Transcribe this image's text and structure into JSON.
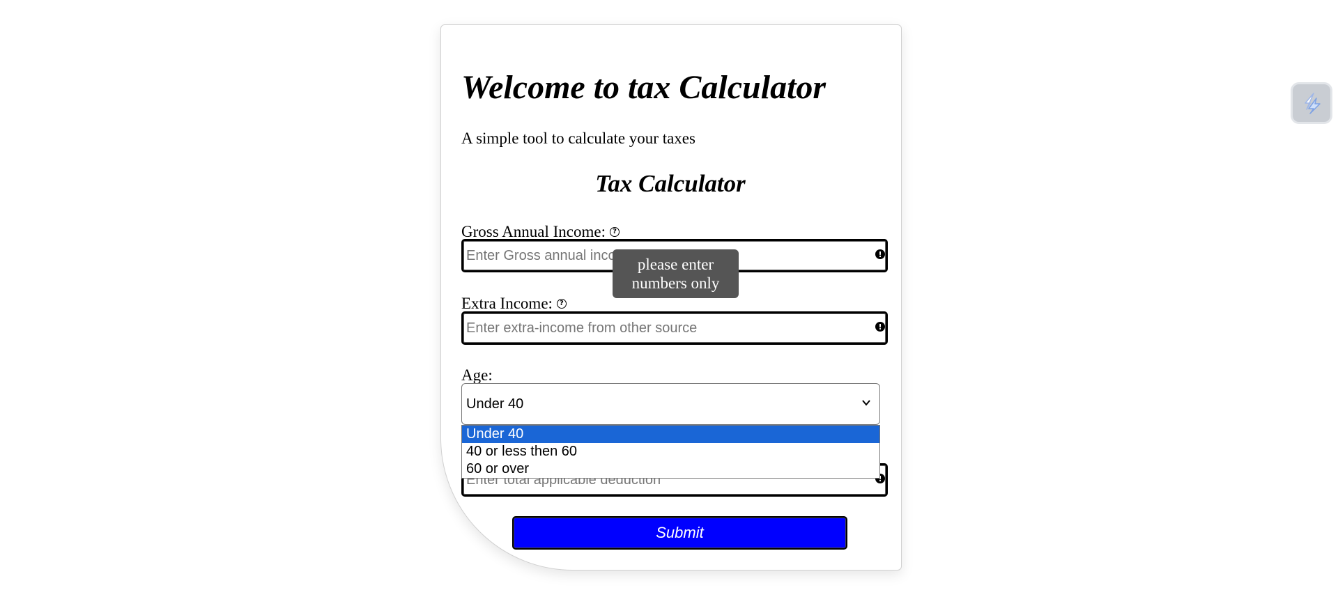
{
  "page": {
    "title": "Welcome to tax Calculator",
    "subtitle": "A simple tool to calculate your taxes"
  },
  "form": {
    "heading": "Tax Calculator",
    "gross_income": {
      "label": "Gross Annual Income:",
      "placeholder": "Enter Gross annual income",
      "value": ""
    },
    "extra_income": {
      "label": "Extra Income:",
      "placeholder": "Enter extra-income from other source",
      "value": ""
    },
    "age": {
      "label": "Age:",
      "selected": "Under 40",
      "options": [
        "Under 40",
        "40 or less then 60",
        "60 or over"
      ]
    },
    "deductions": {
      "placeholder": "Enter total applicable deduction",
      "value": ""
    },
    "tooltip": "please enter numbers only",
    "submit_label": "Submit"
  },
  "icons": {
    "help": "question-circle-icon",
    "error": "exclamation-circle-icon",
    "dropdown": "chevron-down-icon",
    "extension": "extension-icon"
  },
  "colors": {
    "submit_bg": "#0000ff",
    "option_selected_bg": "#1a66d6",
    "tooltip_bg": "#555555"
  }
}
